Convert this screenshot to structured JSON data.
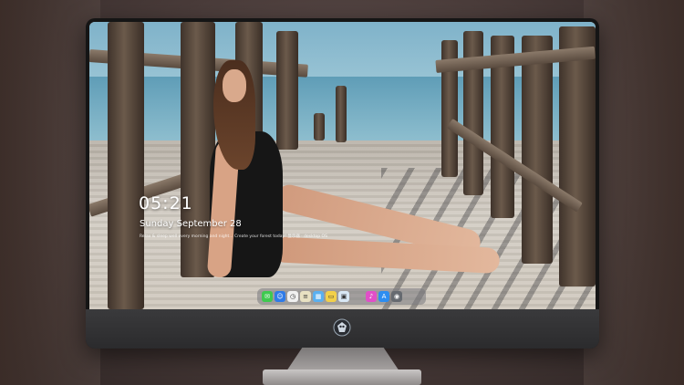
{
  "lockscreen": {
    "time": "05:21",
    "date": "Sunday September  28",
    "subtitle": "Relax & sleep well every morning and night... Create your forest today! 显示器 · desktop OS"
  },
  "dock": {
    "icons": [
      {
        "name": "messages-icon",
        "color": "#3fc94f",
        "glyph": "✉"
      },
      {
        "name": "finder-icon",
        "color": "#2f7be8",
        "glyph": "☺"
      },
      {
        "name": "clock-icon",
        "color": "#f0f0f0",
        "glyph": "◷"
      },
      {
        "name": "notes-icon",
        "color": "#e8e1c2",
        "glyph": "≡"
      },
      {
        "name": "launchpad-icon",
        "color": "#5ab0f0",
        "glyph": "▦"
      },
      {
        "name": "files-icon",
        "color": "#f2d04a",
        "glyph": "▭"
      },
      {
        "name": "photos-icon",
        "color": "#d8e7f4",
        "glyph": "▣"
      },
      {
        "name": "music-icon",
        "color": "#e14fc8",
        "glyph": "♪"
      },
      {
        "name": "app-store-icon",
        "color": "#2c8df0",
        "glyph": "A"
      },
      {
        "name": "camera-icon",
        "color": "#666a70",
        "glyph": "◉"
      }
    ]
  },
  "colors": {
    "monitor_bezel": "#151515",
    "chin": "#2b2b2d",
    "stand": "#a7a3a2"
  }
}
